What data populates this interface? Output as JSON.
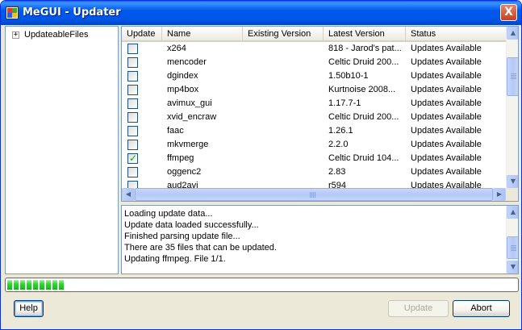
{
  "window": {
    "title": "MeGUI - Updater",
    "close_label": "X"
  },
  "tree": {
    "expander": "+",
    "root_label": "UpdateableFiles"
  },
  "grid": {
    "columns": [
      "Update",
      "Name",
      "Existing Version",
      "Latest Version",
      "Status"
    ],
    "rows": [
      {
        "checked": false,
        "name": "x264",
        "existing": "",
        "latest": "818 - Jarod's pat...",
        "status": "Updates Available"
      },
      {
        "checked": false,
        "name": "mencoder",
        "existing": "",
        "latest": "Celtic Druid 200...",
        "status": "Updates Available"
      },
      {
        "checked": false,
        "name": "dgindex",
        "existing": "",
        "latest": "1.50b10-1",
        "status": "Updates Available"
      },
      {
        "checked": false,
        "name": "mp4box",
        "existing": "",
        "latest": "Kurtnoise 2008...",
        "status": "Updates Available"
      },
      {
        "checked": false,
        "name": "avimux_gui",
        "existing": "",
        "latest": "1.17.7-1",
        "status": "Updates Available"
      },
      {
        "checked": false,
        "name": "xvid_encraw",
        "existing": "",
        "latest": "Celtic Druid 200...",
        "status": "Updates Available"
      },
      {
        "checked": false,
        "name": "faac",
        "existing": "",
        "latest": "1.26.1",
        "status": "Updates Available"
      },
      {
        "checked": false,
        "name": "mkvmerge",
        "existing": "",
        "latest": "2.2.0",
        "status": "Updates Available"
      },
      {
        "checked": true,
        "name": "ffmpeg",
        "existing": "",
        "latest": "Celtic Druid 104...",
        "status": "Updates Available"
      },
      {
        "checked": false,
        "name": "oggenc2",
        "existing": "",
        "latest": "2.83",
        "status": "Updates Available"
      },
      {
        "checked": false,
        "name": "aud2avi",
        "existing": "",
        "latest": "r594",
        "status": "Updates Available"
      }
    ],
    "check_mark": "✓"
  },
  "scroll_arrows": {
    "up": "▲",
    "down": "▼",
    "left": "◀",
    "right": "▶"
  },
  "log": {
    "lines": [
      "Loading update data...",
      "Update data loaded successfully...",
      "Finished parsing update file...",
      "There are 35 files that can be updated.",
      "Updating ffmpeg. File 1/1."
    ]
  },
  "progress": {
    "chunks": 9
  },
  "buttons": {
    "help": "Help",
    "update": "Update",
    "abort": "Abort"
  },
  "colors": {
    "titlebar": "#0058EE",
    "window_bg": "#ECE9D8",
    "progress": "#2FD82F"
  }
}
